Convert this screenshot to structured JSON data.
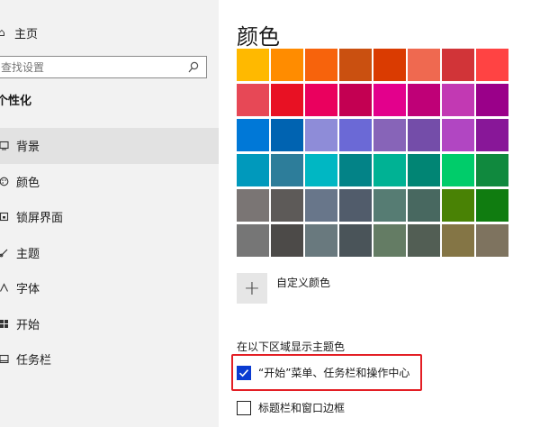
{
  "sidebar": {
    "home": {
      "label": "主页",
      "icon": "home-icon"
    },
    "search": {
      "placeholder": "查找设置",
      "icon": "search-icon"
    },
    "section_title": "个性化",
    "items": [
      {
        "label": "背景",
        "icon": "image-icon",
        "active": true
      },
      {
        "label": "颜色",
        "icon": "palette-icon",
        "active": false
      },
      {
        "label": "锁屏界面",
        "icon": "lock-screen-icon",
        "active": false
      },
      {
        "label": "主题",
        "icon": "brush-icon",
        "active": false
      },
      {
        "label": "字体",
        "icon": "font-icon",
        "active": false
      },
      {
        "label": "开始",
        "icon": "start-icon",
        "active": false
      },
      {
        "label": "任务栏",
        "icon": "taskbar-icon",
        "active": false
      }
    ]
  },
  "main": {
    "title": "颜色",
    "palette": [
      "#ffb900",
      "#ff8c00",
      "#f7630c",
      "#ca5010",
      "#da3b01",
      "#ef6950",
      "#d13438",
      "#ff4343",
      "#e74856",
      "#e81123",
      "#ea005e",
      "#c30052",
      "#e3008c",
      "#bf0077",
      "#c239b3",
      "#9a0089",
      "#0078d7",
      "#0063b1",
      "#8e8cd8",
      "#6b69d6",
      "#8764b8",
      "#744da9",
      "#b146c2",
      "#881798",
      "#0099bc",
      "#2d7d9a",
      "#00b7c3",
      "#038387",
      "#00b294",
      "#018574",
      "#00cc6a",
      "#10893e",
      "#7a7574",
      "#5d5a58",
      "#68768a",
      "#515c6b",
      "#567c73",
      "#486860",
      "#498205",
      "#107c10",
      "#767676",
      "#4c4a48",
      "#69797e",
      "#4a5459",
      "#647c64",
      "#525e54",
      "#847545",
      "#7e735f"
    ],
    "custom_color": {
      "label": "自定义颜色",
      "icon": "plus-icon"
    },
    "show_accent_title": "在以下区域显示主题色",
    "checkboxes": [
      {
        "label": "“开始”菜单、任务栏和操作中心",
        "checked": true
      },
      {
        "label": "标题栏和窗口边框",
        "checked": false
      }
    ],
    "highlight_color": "#e31e24",
    "check_color": "#0b3bd1"
  }
}
